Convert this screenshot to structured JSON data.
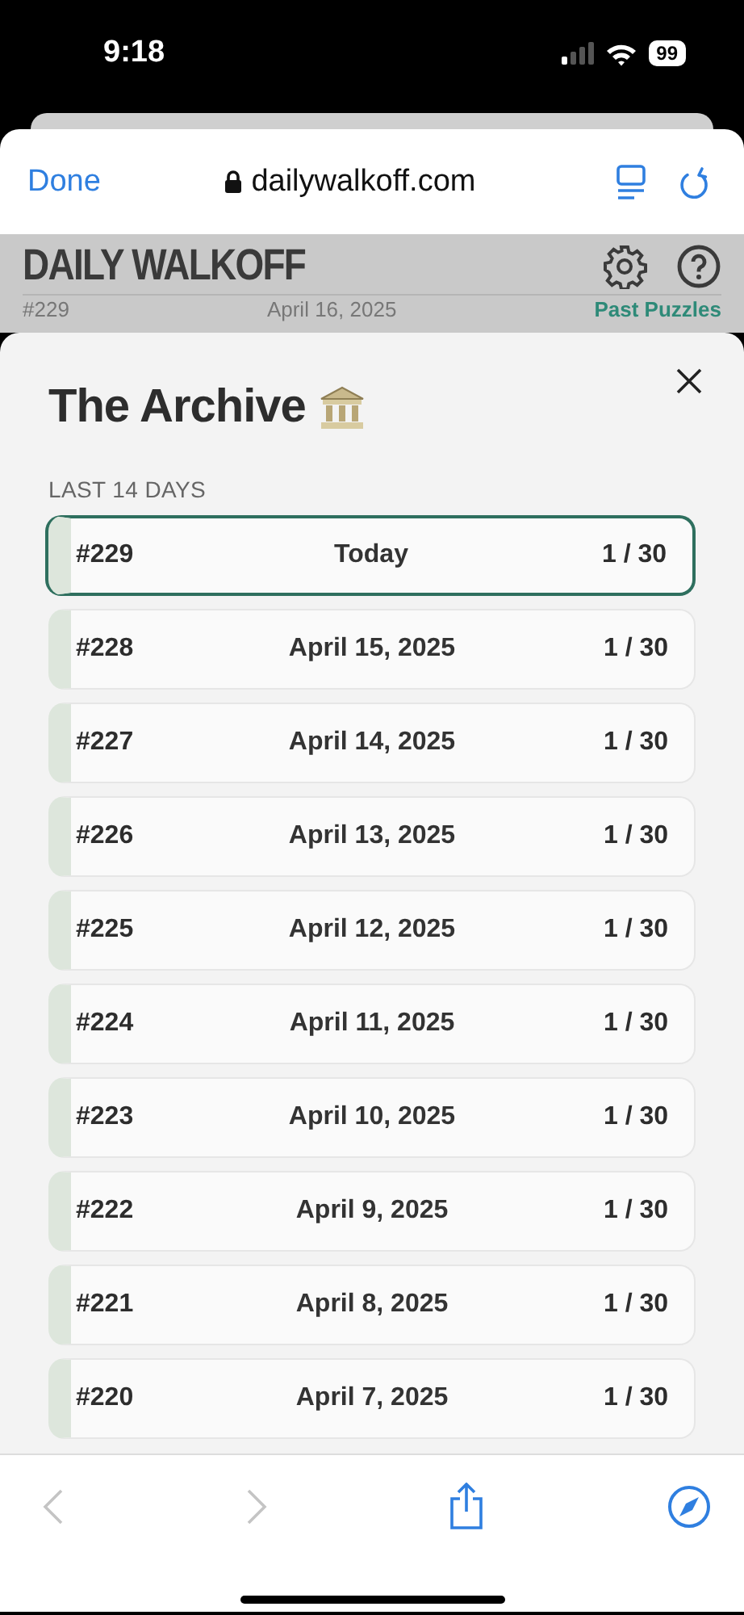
{
  "status_bar": {
    "time": "9:18",
    "battery": "99"
  },
  "browser": {
    "done": "Done",
    "url": "dailywalkoff.com"
  },
  "page_header": {
    "title": "DAILY WALKOFF",
    "puzzle": "#229",
    "date": "April 16, 2025",
    "link": "Past Puzzles"
  },
  "modal": {
    "title": "The Archive",
    "section": "LAST 14 DAYS",
    "rows": [
      {
        "number": "#229",
        "date": "Today",
        "score": "1 / 30",
        "selected": true
      },
      {
        "number": "#228",
        "date": "April 15, 2025",
        "score": "1 / 30",
        "selected": false
      },
      {
        "number": "#227",
        "date": "April 14, 2025",
        "score": "1 / 30",
        "selected": false
      },
      {
        "number": "#226",
        "date": "April 13, 2025",
        "score": "1 / 30",
        "selected": false
      },
      {
        "number": "#225",
        "date": "April 12, 2025",
        "score": "1 / 30",
        "selected": false
      },
      {
        "number": "#224",
        "date": "April 11, 2025",
        "score": "1 / 30",
        "selected": false
      },
      {
        "number": "#223",
        "date": "April 10, 2025",
        "score": "1 / 30",
        "selected": false
      },
      {
        "number": "#222",
        "date": "April 9, 2025",
        "score": "1 / 30",
        "selected": false
      },
      {
        "number": "#221",
        "date": "April 8, 2025",
        "score": "1 / 30",
        "selected": false
      },
      {
        "number": "#220",
        "date": "April 7, 2025",
        "score": "1 / 30",
        "selected": false
      }
    ]
  },
  "toolbar": {
    "back_disabled": true,
    "forward_disabled": true
  }
}
